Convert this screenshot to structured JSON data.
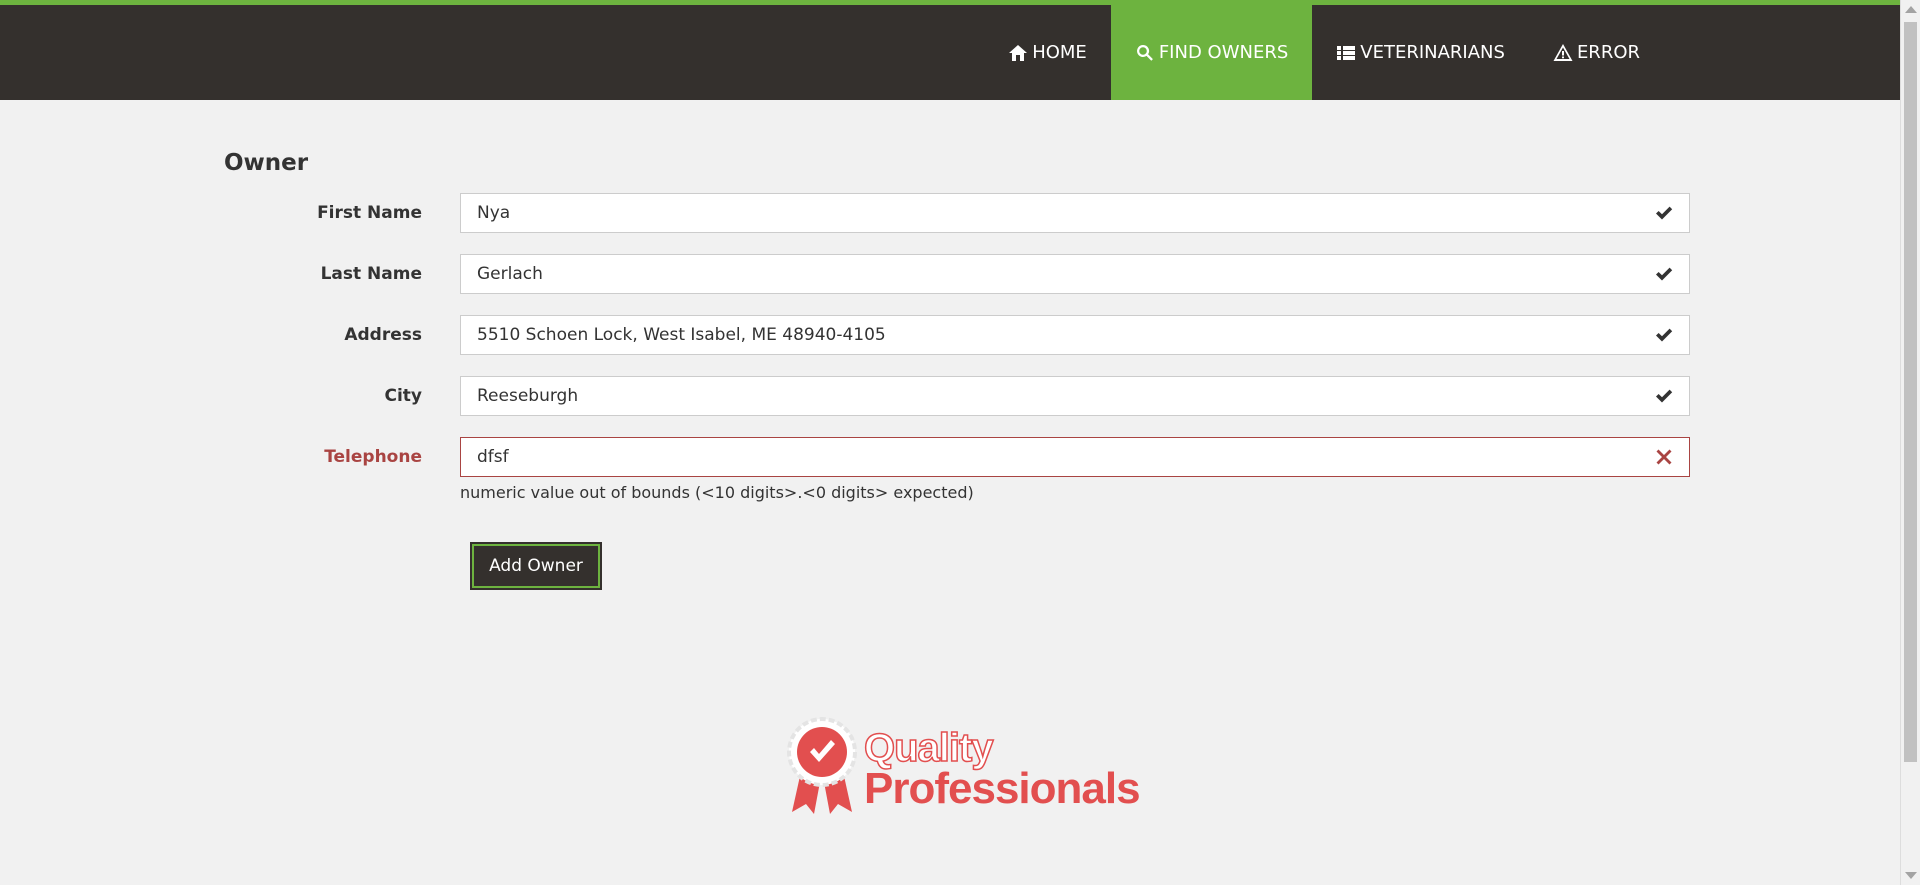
{
  "nav": {
    "items": [
      {
        "label": "Home",
        "icon": "home-icon",
        "active": false
      },
      {
        "label": "Find owners",
        "icon": "search-icon",
        "active": true
      },
      {
        "label": "Veterinarians",
        "icon": "list-icon",
        "active": false
      },
      {
        "label": "Error",
        "icon": "warning-icon",
        "active": false
      }
    ]
  },
  "form": {
    "title": "Owner",
    "fields": [
      {
        "label": "First Name",
        "value": "Nya",
        "status": "valid"
      },
      {
        "label": "Last Name",
        "value": "Gerlach",
        "status": "valid"
      },
      {
        "label": "Address",
        "value": "5510 Schoen Lock, West Isabel, ME 48940-4105",
        "status": "valid"
      },
      {
        "label": "City",
        "value": "Reeseburgh",
        "status": "valid"
      },
      {
        "label": "Telephone",
        "value": "dfsf",
        "status": "error",
        "help": "numeric value out of bounds (<10 digits>.<0 digits> expected)"
      }
    ],
    "submit_label": "Add Owner"
  },
  "footer": {
    "logo_line1": "Quality",
    "logo_line2": "Professionals"
  },
  "colors": {
    "brand_green": "#6db33f",
    "nav_bg": "#34302d",
    "error": "#a94442",
    "logo_red": "#e24f4f"
  }
}
